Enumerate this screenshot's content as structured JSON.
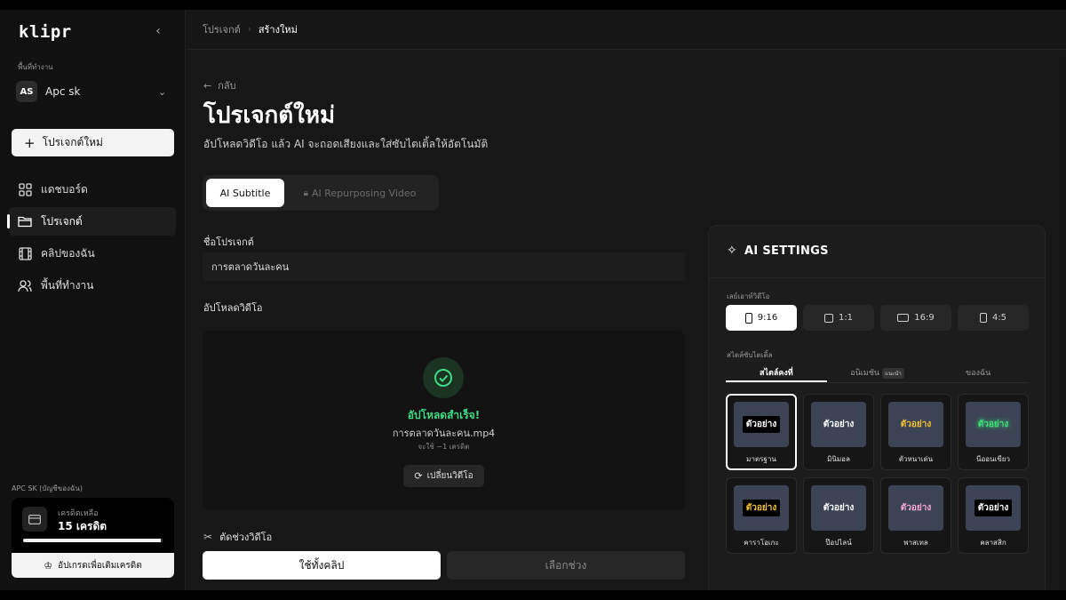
{
  "app": {
    "logo": "klipr"
  },
  "sidebar": {
    "collapse_icon": "chevron-left-icon",
    "workspace_label": "พื้นที่ทำงาน",
    "workspace": {
      "initials": "AS",
      "name": "Apc sk"
    },
    "new_project_label": "โปรเจกต์ใหม่",
    "nav": [
      {
        "label": "แดชบอร์ด",
        "icon": "dashboard-icon"
      },
      {
        "label": "โปรเจกต์",
        "icon": "folder-icon",
        "active": true
      },
      {
        "label": "คลิปของฉัน",
        "icon": "film-icon"
      },
      {
        "label": "พื้นที่ทำงาน",
        "icon": "users-icon"
      }
    ],
    "account_label": "APC SK (บัญชีของฉัน)",
    "credits": {
      "label": "เครดิตเหลือ",
      "value": "15 เครดิต",
      "fraction": 0.99
    },
    "upgrade_label": "อัปเกรดเพื่อเติมเครดิต"
  },
  "topbar": {
    "crumb_parent": "โปรเจกต์",
    "crumb_current": "สร้างใหม่"
  },
  "main": {
    "back_label": "กลับ",
    "title": "โปรเจกต์ใหม่",
    "subtitle": "อัปโหลดวิดีโอ แล้ว AI จะถอดเสียงและใส่ซับไตเติ้ลให้อัตโนมัติ",
    "mode_tabs": {
      "active": "AI Subtitle",
      "locked": "AI Repurposing Video"
    },
    "project_name_label": "ชื่อโปรเจกต์",
    "project_name_value": "การตลาดวันละคน",
    "upload_label": "อัปโหลดวิดีโอ",
    "upload": {
      "status": "อัปโหลดสำเร็จ!",
      "file_name": "การตลาดวันละคน.mp4",
      "cost": "จะใช้ ~1 เครดิต",
      "replace_label": "เปลี่ยนวิดีโอ"
    },
    "trim_label": "ตัดช่วงวิดีโอ",
    "trim_full": "ใช้ทั้งคลิป",
    "trim_range": "เลือกช่วง"
  },
  "ai_settings": {
    "title": "AI SETTINGS",
    "layout_label": "เลย์เอาท์วิดีโอ",
    "layouts": [
      "9:16",
      "1:1",
      "16:9",
      "4:5"
    ],
    "selected_layout": "9:16",
    "style_label": "สไตล์ซับไตเติ้ล",
    "style_tabs": {
      "static": "สไตล์คงที่",
      "animated": "อนิเมชัน",
      "animated_badge": "แนะนำ",
      "mine": "ของฉัน"
    },
    "sample_text": "ตัวอย่าง",
    "styles": [
      {
        "name": "มาตรฐาน",
        "bg": "#000000",
        "fg": "#ffffff"
      },
      {
        "name": "มินิมอล",
        "bg": "transparent",
        "fg": "#ffffff"
      },
      {
        "name": "ตัวหนาเด่น",
        "bg": "transparent",
        "fg": "#f2c230"
      },
      {
        "name": "นีออนเขียว",
        "bg": "transparent",
        "fg": "#3ee07a"
      },
      {
        "name": "คาราโอเกะ",
        "bg": "#000000",
        "fg": "#f2c230"
      },
      {
        "name": "ป๊อปไลน์",
        "bg": "transparent",
        "fg": "#ffffff"
      },
      {
        "name": "พาสเทล",
        "bg": "transparent",
        "fg": "#f4a7d0"
      },
      {
        "name": "คลาสสิก",
        "bg": "#000000",
        "fg": "#ffffff"
      }
    ],
    "selected_style": "มาตรฐาน"
  }
}
